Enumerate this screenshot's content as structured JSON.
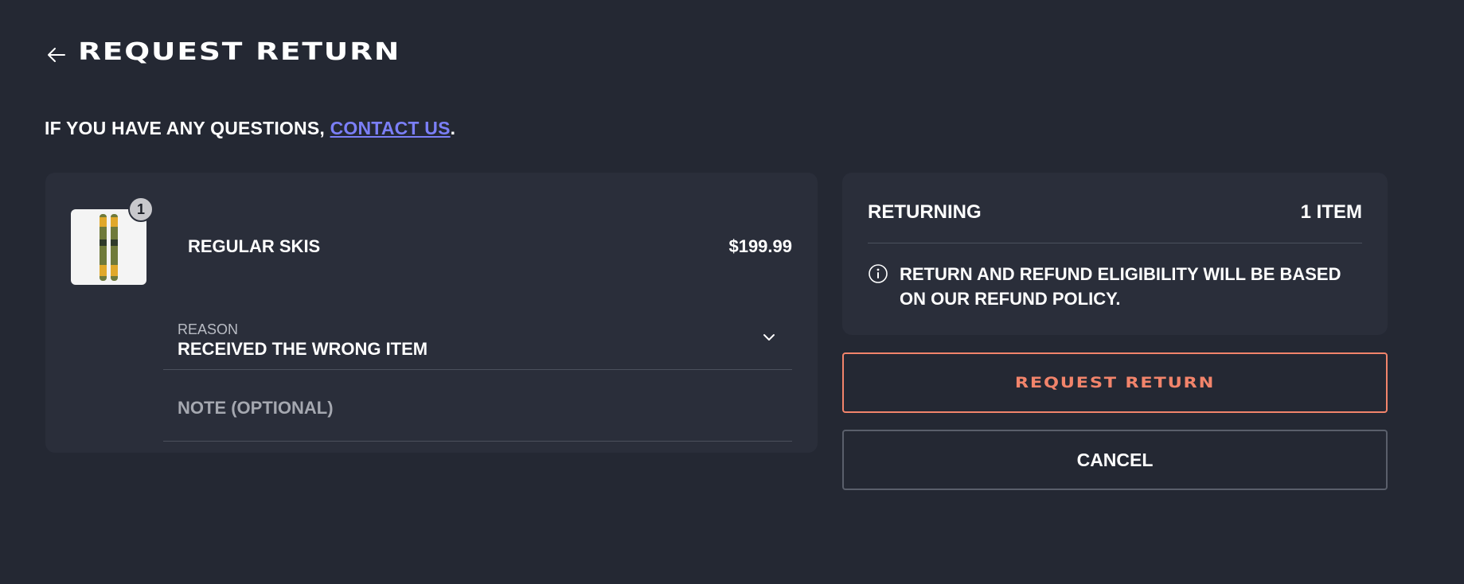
{
  "header": {
    "title": "REQUEST RETURN",
    "back_icon": "arrow-left-icon"
  },
  "help": {
    "prefix": "IF YOU HAVE ANY QUESTIONS, ",
    "link_label": "CONTACT US",
    "suffix": "."
  },
  "item": {
    "name": "REGULAR SKIS",
    "price": "$199.99",
    "quantity": "1",
    "image_icon": "skis-thumbnail",
    "reason": {
      "label": "REASON",
      "value": "RECEIVED THE WRONG ITEM",
      "icon": "chevron-down-icon"
    },
    "note": {
      "placeholder": "NOTE (OPTIONAL)",
      "value": ""
    }
  },
  "summary": {
    "label": "RETURNING",
    "count": "1 ITEM",
    "policy_text": "RETURN AND REFUND ELIGIBILITY WILL BE BASED ON OUR REFUND POLICY.",
    "info_icon": "info-icon"
  },
  "actions": {
    "request_label": "REQUEST RETURN",
    "cancel_label": "CANCEL"
  },
  "colors": {
    "background": "#242833",
    "card": "#2a2e3a",
    "accent": "#f2846b",
    "link": "#7b7ff7"
  }
}
